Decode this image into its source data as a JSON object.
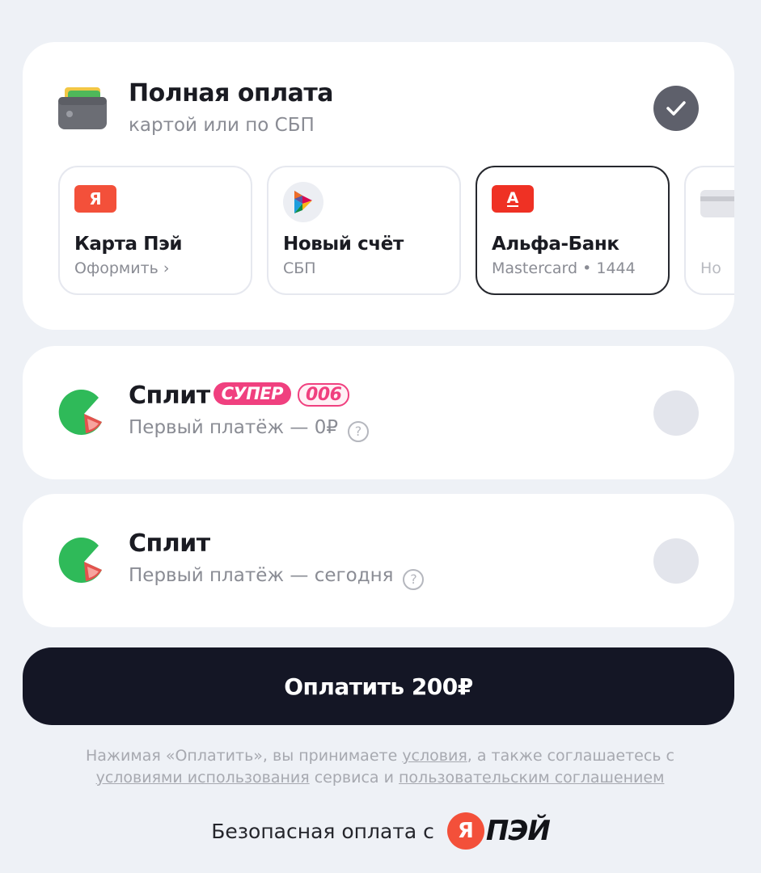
{
  "full_payment": {
    "title": "Полная оплата",
    "subtitle": "картой или по СБП",
    "selected": true,
    "methods": [
      {
        "logo_text": "Я",
        "title": "Карта Пэй",
        "subtitle": "Оформить ›",
        "logo_color": "#f3503a"
      },
      {
        "logo_text": "",
        "title": "Новый счёт",
        "subtitle": "СБП"
      },
      {
        "logo_text": "А",
        "title": "Альфа-Банк",
        "subtitle": "Mastercard • 1444",
        "logo_color": "#ef3124",
        "selected": true
      },
      {
        "logo_text": "",
        "title": "",
        "subtitle": "Но"
      }
    ]
  },
  "split_super": {
    "title": "Сплит",
    "badge_super": "СУПЕР",
    "badge_006": "006",
    "subtitle": "Первый платёж — 0₽",
    "help": "?"
  },
  "split": {
    "title": "Сплит",
    "subtitle": "Первый платёж — сегодня",
    "help": "?"
  },
  "pay_button": {
    "label": "Оплатить 200₽"
  },
  "terms": {
    "part1": "Нажимая «Оплатить», вы принимаете ",
    "link1": "условия",
    "part2": ", а также соглашаетесь с ",
    "link2": "условиями использования",
    "part3": " сервиса и ",
    "link3": "пользовательским соглашением"
  },
  "secure": {
    "text": "Безопасная оплата с",
    "logo_letter": "Я",
    "logo_text": "ПЭЙ"
  },
  "colors": {
    "accent_pink": "#f0407f",
    "button_dark": "#141625",
    "background": "#eef1f6"
  }
}
